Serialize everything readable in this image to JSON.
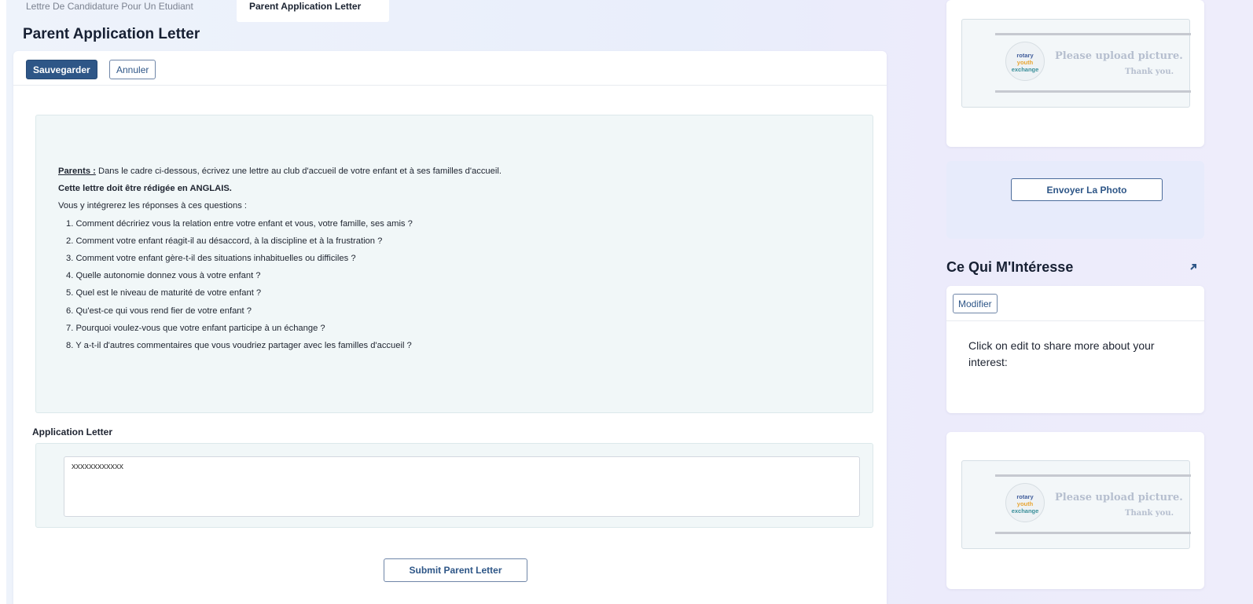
{
  "tabs": [
    {
      "label": "Lettre De Candidature Pour Un Etudiant",
      "active": false
    },
    {
      "label": "Parent Application Letter",
      "active": true
    }
  ],
  "page_title": "Parent Application Letter",
  "toolbar": {
    "save_label": "Sauvegarder",
    "cancel_label": "Annuler"
  },
  "instructions": {
    "parents_label": "Parents :",
    "intro": " Dans le cadre ci-dessous, écrivez une lettre au club d'accueil de votre enfant et à ses familles d'accueil.",
    "english_note": "Cette lettre doit être rédigée en ANGLAIS.",
    "questions_intro": "Vous y intégrerez les réponses à ces questions :",
    "questions": [
      "1. Comment décririez vous la relation entre votre enfant et vous, votre famille, ses amis ?",
      "2. Comment votre enfant réagit-il au désaccord, à la discipline et à la frustration ?",
      "3. Comment votre enfant gère-t-il des situations inhabituelles ou difficiles ?",
      "4. Quelle autonomie donnez vous à votre enfant ?",
      "5. Quel est le niveau de maturité de votre enfant ?",
      "6. Qu'est-ce qui vous rend fier de votre enfant ?",
      "7. Pourquoi voulez-vous que votre enfant participe à un échange ?",
      "8. Y a-t-il d'autres commentaires que vous voudriez partager avec les familles d'accueil ?"
    ]
  },
  "application_letter": {
    "label": "Application Letter",
    "value": "xxxxxxxxxxxx"
  },
  "submit_label": "Submit Parent Letter",
  "photo_placeholder": {
    "logo_line1": "rotary",
    "logo_line2": "youth",
    "logo_line3": "exchange",
    "line1": "Please upload picture.",
    "line2": "Thank you."
  },
  "upload_label": "Envoyer La Photo",
  "interests": {
    "title": "Ce Qui M'Intéresse",
    "modify_label": "Modifier",
    "text": "Click on edit to share more about your interest:"
  },
  "colors": {
    "primary": "#2e5687",
    "panel_bg": "#f1f7f8",
    "page_bg": "#eef3fb"
  }
}
